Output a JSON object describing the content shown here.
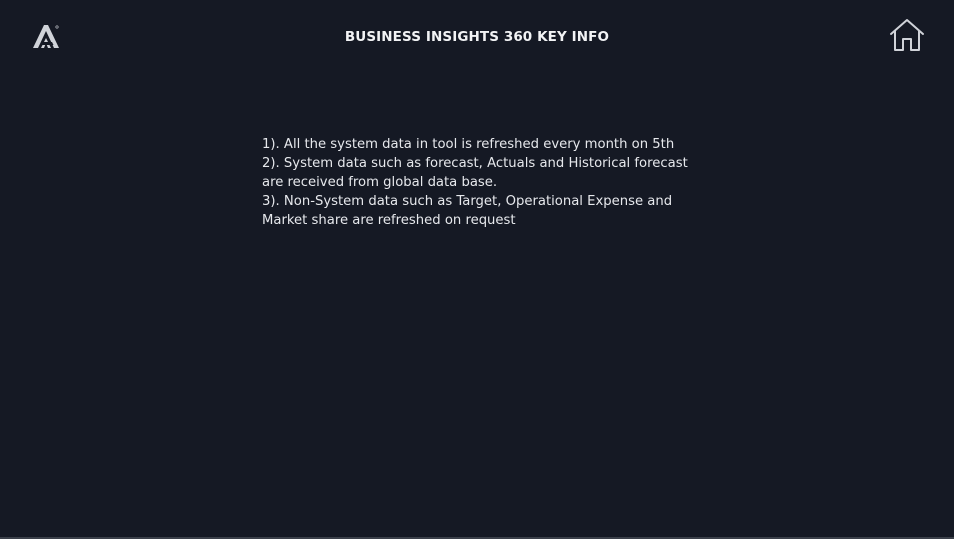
{
  "header": {
    "logo_icon": "brand-a-logo",
    "title": "BUSINESS INSIGHTS 360 KEY INFO",
    "home_icon": "home-icon"
  },
  "info": {
    "items": [
      "1). All the system data in tool is refreshed every month on 5th",
      "2). System data such as forecast, Actuals and Historical forecast are received from global data base.",
      "3). Non-System data such as Target, Operational Expense and Market share are refreshed on request"
    ]
  },
  "colors": {
    "background": "#151924",
    "text": "#e6e8ec",
    "icon": "#d0d3d9"
  }
}
